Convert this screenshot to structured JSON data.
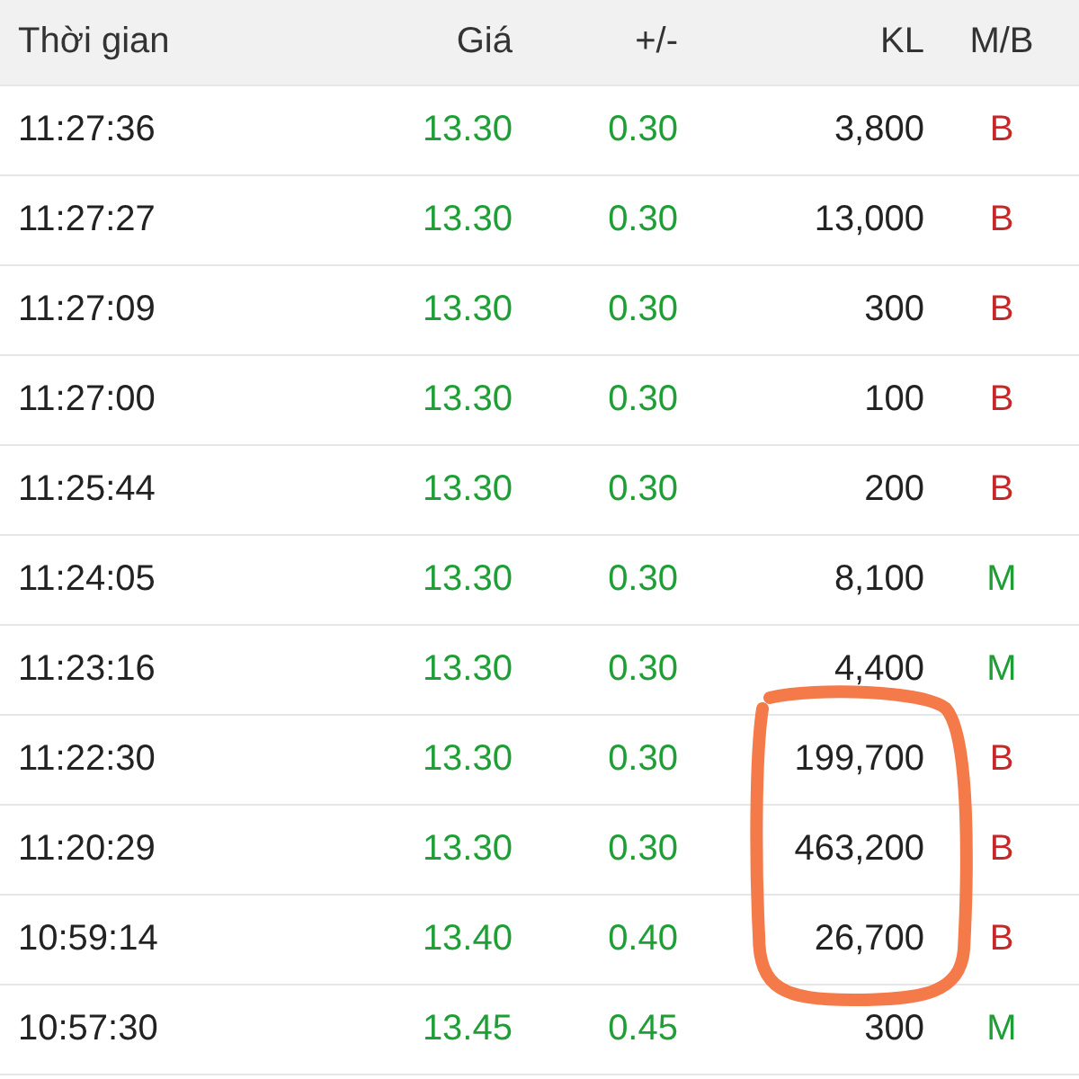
{
  "columns": [
    "Thời gian",
    "Giá",
    "+/-",
    "KL",
    "M/B"
  ],
  "rows": [
    {
      "time": "11:27:36",
      "price": "13.30",
      "change": "0.30",
      "volume": "3,800",
      "side": "B",
      "kind": "sell"
    },
    {
      "time": "11:27:27",
      "price": "13.30",
      "change": "0.30",
      "volume": "13,000",
      "side": "B",
      "kind": "sell"
    },
    {
      "time": "11:27:09",
      "price": "13.30",
      "change": "0.30",
      "volume": "300",
      "side": "B",
      "kind": "sell"
    },
    {
      "time": "11:27:00",
      "price": "13.30",
      "change": "0.30",
      "volume": "100",
      "side": "B",
      "kind": "sell"
    },
    {
      "time": "11:25:44",
      "price": "13.30",
      "change": "0.30",
      "volume": "200",
      "side": "B",
      "kind": "sell"
    },
    {
      "time": "11:24:05",
      "price": "13.30",
      "change": "0.30",
      "volume": "8,100",
      "side": "M",
      "kind": "buy"
    },
    {
      "time": "11:23:16",
      "price": "13.30",
      "change": "0.30",
      "volume": "4,400",
      "side": "M",
      "kind": "buy"
    },
    {
      "time": "11:22:30",
      "price": "13.30",
      "change": "0.30",
      "volume": "199,700",
      "side": "B",
      "kind": "sell"
    },
    {
      "time": "11:20:29",
      "price": "13.30",
      "change": "0.30",
      "volume": "463,200",
      "side": "B",
      "kind": "sell"
    },
    {
      "time": "10:59:14",
      "price": "13.40",
      "change": "0.40",
      "volume": "26,700",
      "side": "B",
      "kind": "sell"
    },
    {
      "time": "10:57:30",
      "price": "13.45",
      "change": "0.45",
      "volume": "300",
      "side": "M",
      "kind": "buy"
    }
  ]
}
